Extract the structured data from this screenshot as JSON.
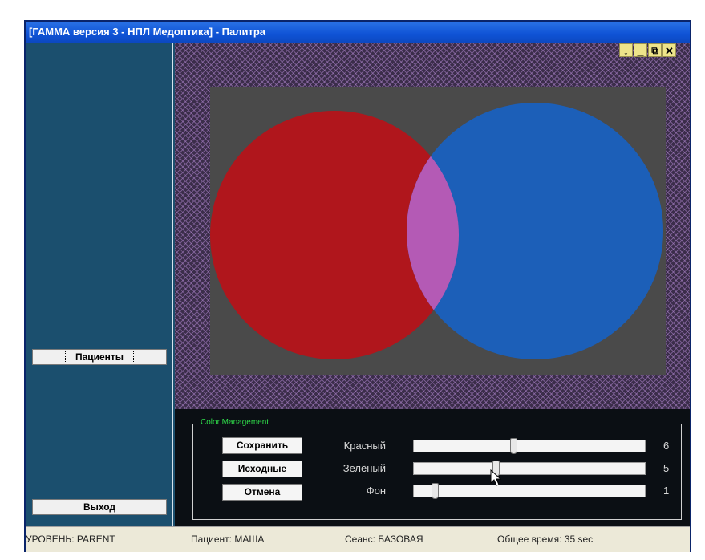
{
  "window": {
    "title": "[ГАММА версия 3 - НПЛ Медоптика] - Палитра",
    "controls": [
      "↓",
      "_",
      "⧉",
      "✕"
    ]
  },
  "sidebar": {
    "patients_label": "Пациенты",
    "exit_label": "Выход"
  },
  "canvas": {
    "left_circle_color": "#b0161c",
    "right_circle_color": "#1c5fb8",
    "overlap_color": "#b45ab5",
    "background_color": "#4a4a4a"
  },
  "color_management": {
    "legend": "Color Management",
    "buttons": {
      "save": "Сохранить",
      "defaults": "Исходные",
      "cancel": "Отмена"
    },
    "sliders": [
      {
        "label": "Красный",
        "value": "6",
        "level": 0.43
      },
      {
        "label": "Зелёный",
        "value": "5",
        "level": 0.35
      },
      {
        "label": "Фон",
        "value": "1",
        "level": 0.08
      }
    ]
  },
  "statusbar": {
    "level": "УРОВЕНЬ: PARENT",
    "patient": "Пациент: МАША",
    "session": "Сеанс: БАЗОВАЯ",
    "total_time": "Общее время: 35 sec"
  }
}
